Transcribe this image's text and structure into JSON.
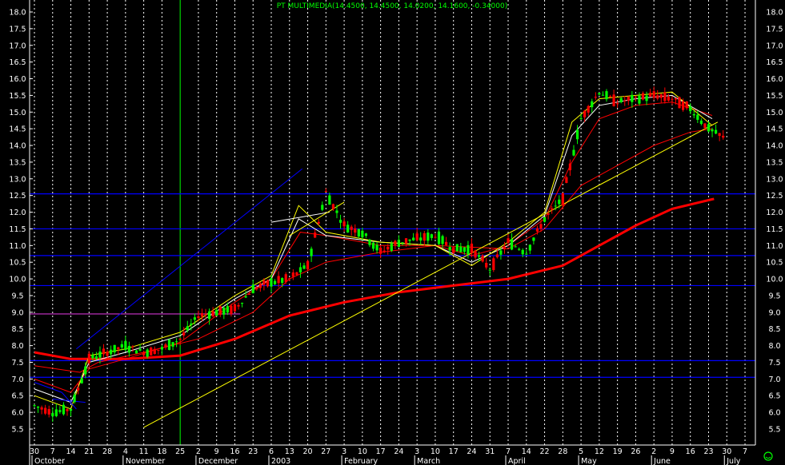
{
  "chart_data": {
    "type": "candlestick",
    "title": "PT MULTIMEDIA(14.4500, 14.4500, 14.0200, 14.1600, -0.34000)",
    "ylim": [
      5.2,
      18.2
    ],
    "y_ticks": [
      "5.5",
      "6.0",
      "6.5",
      "7.0",
      "7.5",
      "8.0",
      "8.5",
      "9.0",
      "9.5",
      "10.0",
      "10.5",
      "11.0",
      "11.5",
      "12.0",
      "12.5",
      "13.0",
      "13.5",
      "14.0",
      "14.5",
      "15.0",
      "15.5",
      "16.0",
      "16.5",
      "17.0",
      "17.5",
      "18.0"
    ],
    "x_day_labels": [
      "30",
      "7",
      "14",
      "21",
      "28",
      "4",
      "11",
      "18",
      "25",
      "2",
      "9",
      "16",
      "23",
      "6",
      "13",
      "20",
      "27",
      "3",
      "10",
      "17",
      "24",
      "3",
      "10",
      "17",
      "24",
      "31",
      "7",
      "14",
      "22",
      "28",
      "5",
      "12",
      "19",
      "26",
      "2",
      "9",
      "16",
      "23",
      "30",
      "7"
    ],
    "x_month_labels": [
      "October",
      "November",
      "December",
      "2003",
      "February",
      "March",
      "April",
      "May",
      "June",
      "July"
    ],
    "price_closes": [
      6.2,
      6.0,
      6.1,
      7.6,
      7.8,
      8.0,
      7.8,
      7.9,
      8.2,
      8.9,
      9.0,
      9.1,
      9.7,
      9.9,
      10.0,
      10.4,
      12.6,
      11.6,
      11.4,
      10.8,
      11.1,
      11.2,
      11.3,
      10.9,
      10.9,
      10.3,
      11.1,
      10.8,
      11.8,
      12.4,
      14.8,
      15.6,
      15.3,
      15.4,
      15.5,
      15.4,
      15.1,
      14.5,
      14.16
    ],
    "horizontal_levels": [
      12.55,
      11.5,
      10.7,
      9.8,
      7.55,
      7.05
    ],
    "magenta_level": 8.95,
    "trendlines": [
      {
        "color": "#ffff00",
        "from": [
          6.0,
          5.55
        ],
        "to": [
          37.5,
          14.7
        ]
      },
      {
        "color": "#0000ff",
        "from": [
          2.3,
          7.9
        ],
        "to": [
          14.7,
          13.3
        ]
      },
      {
        "color": "#0000ff",
        "from": [
          1.0,
          6.4
        ],
        "to": [
          2.8,
          6.3
        ]
      },
      {
        "color": "#ffffff",
        "from": [
          13.0,
          11.7
        ],
        "to": [
          16.2,
          12.0
        ]
      },
      {
        "color": "#ffff00",
        "from": [
          14.0,
          11.3
        ],
        "to": [
          17.0,
          12.3
        ]
      }
    ],
    "moving_averages": [
      {
        "color": "#ff0000",
        "width": 3,
        "points": [
          [
            0,
            7.8
          ],
          [
            2,
            7.6
          ],
          [
            5,
            7.6
          ],
          [
            8,
            7.7
          ],
          [
            11,
            8.2
          ],
          [
            14,
            8.9
          ],
          [
            17,
            9.3
          ],
          [
            20,
            9.6
          ],
          [
            23,
            9.8
          ],
          [
            26,
            10.0
          ],
          [
            29,
            10.4
          ],
          [
            31,
            11.0
          ],
          [
            33,
            11.6
          ],
          [
            35,
            12.1
          ],
          [
            37.3,
            12.4
          ]
        ]
      },
      {
        "color": "#ff0000",
        "width": 1,
        "points": [
          [
            0,
            7.4
          ],
          [
            2.5,
            7.2
          ],
          [
            3.5,
            7.5
          ],
          [
            6,
            7.8
          ],
          [
            9,
            8.2
          ],
          [
            12,
            9.0
          ],
          [
            14,
            10.0
          ],
          [
            16,
            10.5
          ],
          [
            19,
            10.8
          ],
          [
            22,
            11.0
          ],
          [
            26,
            10.9
          ],
          [
            28,
            11.5
          ],
          [
            30,
            12.8
          ],
          [
            32,
            13.4
          ],
          [
            34,
            14.0
          ],
          [
            36,
            14.4
          ],
          [
            37.2,
            14.5
          ]
        ]
      },
      {
        "color": "#ff0000",
        "width": 1,
        "points": [
          [
            0,
            7.0
          ],
          [
            2,
            6.6
          ],
          [
            3,
            7.3
          ],
          [
            5,
            7.6
          ],
          [
            8,
            8.1
          ],
          [
            11,
            9.3
          ],
          [
            13,
            10.0
          ],
          [
            14.6,
            11.4
          ],
          [
            16,
            11.3
          ],
          [
            19,
            11.0
          ],
          [
            22,
            11.0
          ],
          [
            24,
            10.7
          ],
          [
            26,
            11.0
          ],
          [
            28,
            11.8
          ],
          [
            29.5,
            13.5
          ],
          [
            31,
            14.8
          ],
          [
            33,
            15.2
          ],
          [
            35,
            15.3
          ],
          [
            37.2,
            14.9
          ]
        ]
      },
      {
        "color": "#ffffff",
        "width": 1,
        "points": [
          [
            0,
            6.7
          ],
          [
            2,
            6.3
          ],
          [
            3,
            7.5
          ],
          [
            5,
            7.8
          ],
          [
            8,
            8.3
          ],
          [
            11,
            9.4
          ],
          [
            13,
            10.0
          ],
          [
            14.5,
            11.8
          ],
          [
            16,
            11.3
          ],
          [
            19,
            11.1
          ],
          [
            22,
            11.0
          ],
          [
            24,
            10.5
          ],
          [
            26,
            11.0
          ],
          [
            28,
            11.9
          ],
          [
            29.5,
            14.3
          ],
          [
            31,
            15.2
          ],
          [
            33,
            15.4
          ],
          [
            35,
            15.5
          ],
          [
            37.2,
            14.8
          ]
        ]
      },
      {
        "color": "#ffff00",
        "width": 1,
        "points": [
          [
            0,
            6.5
          ],
          [
            2,
            6.1
          ],
          [
            3,
            7.7
          ],
          [
            5,
            7.9
          ],
          [
            8,
            8.4
          ],
          [
            11,
            9.5
          ],
          [
            13,
            10.1
          ],
          [
            14.5,
            12.2
          ],
          [
            16,
            11.4
          ],
          [
            19,
            11.1
          ],
          [
            22,
            11.0
          ],
          [
            24,
            10.4
          ],
          [
            26,
            11.1
          ],
          [
            28,
            12.0
          ],
          [
            29.5,
            14.7
          ],
          [
            31,
            15.4
          ],
          [
            33,
            15.5
          ],
          [
            35,
            15.6
          ],
          [
            37.2,
            14.6
          ]
        ]
      },
      {
        "color": "#0000ff",
        "width": 1,
        "points": [
          [
            0,
            6.9
          ],
          [
            1.5,
            6.6
          ],
          [
            2.3,
            6.1
          ]
        ]
      }
    ]
  },
  "status_icon": "smiley-icon",
  "colors": {
    "background": "#000000",
    "grid_vertical": "#ffffff",
    "grid_current": "#00ff00",
    "level_lines": "#0000ff",
    "up_candle": "#00ff00",
    "down_candle": "#ff0000",
    "axis_text": "#ffffff",
    "title_text": "#00ff00"
  }
}
